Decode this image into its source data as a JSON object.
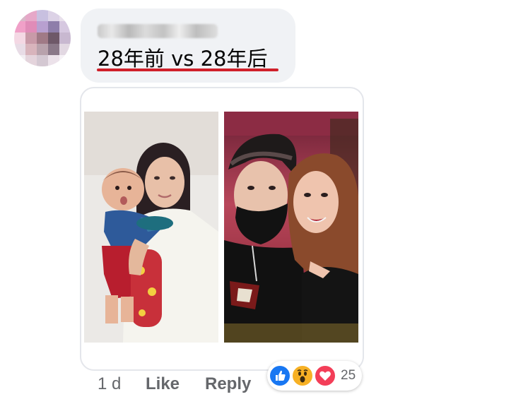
{
  "comment": {
    "author_name": "",
    "text": "28年前 vs 28年后",
    "timestamp": "1 d",
    "actions": {
      "like_label": "Like",
      "reply_label": "Reply"
    },
    "reactions": {
      "types": [
        "like",
        "wow",
        "love"
      ],
      "count": "25"
    }
  },
  "colors": {
    "bubble_bg": "#f0f2f5",
    "underline": "#d0202a",
    "meta_text": "#65676b",
    "like_blue": "#1877f2",
    "wow_yellow": "#f7b125",
    "love_red": "#f33e58"
  },
  "images": [
    {
      "name": "photo-left",
      "description_icon": "mother-and-baby-photo"
    },
    {
      "name": "photo-right",
      "description_icon": "mother-and-adult-son-selfie"
    }
  ]
}
